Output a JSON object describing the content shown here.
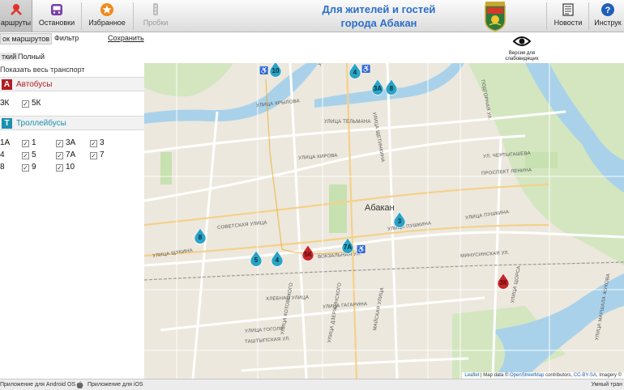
{
  "toolbar": {
    "routes_label": "аршруты",
    "stops_label": "Остановки",
    "favorites_label": "Избранное",
    "traffic_label": "Пробки",
    "news_label": "Новости",
    "instructions_label": "Инструк"
  },
  "header": {
    "title_line1": "Для жителей и гостей",
    "title_line2": "города Абакан"
  },
  "subtabs": {
    "route_list": "ок маршрутов",
    "filter": "Фильтр",
    "save": "Сохранить"
  },
  "modes": {
    "short": "ткий",
    "full": "Полный"
  },
  "show_all": "Показать весь транспорт",
  "bus_section": {
    "badge": "А",
    "title": "Автобусы",
    "color": "#b01e23"
  },
  "bus_routes": [
    "3К",
    "5К"
  ],
  "trolley_section": {
    "badge": "Т",
    "title": "Троллейбусы",
    "color": "#1c8fae"
  },
  "trolley_routes": [
    "1А",
    "1",
    "3А",
    "3",
    "4",
    "5",
    "7А",
    "7",
    "8",
    "9",
    "10"
  ],
  "vision": {
    "label1": "Версия для",
    "label2": "слабовидящих"
  },
  "map": {
    "city": "Абакан",
    "streets": [
      "УЛИЦА КРЫЛОВА",
      "УЛИЦА ТЕЛЬМАНА",
      "УЛИЦА КАТИ ТРО",
      "ПОДГОРНАЯ УЛ.",
      "УЛИЦА ЩЕТИНКИНА",
      "УЛИЦА КИРОВА",
      "УЛ. ЧЕРТЫГАШЕВА",
      "ПРОСПЕКТ ЛЕНИНА",
      "УЛИЦА ПУШКИНА",
      "УЛИЦА ПУШКИНА",
      "СОВЕТСКАЯ УЛИЦА",
      "ВОКЗАЛЬНАЯ УЛ.",
      "МИНУСИНСКАЯ УЛ.",
      "УЛИЦА ЩОРСА",
      "ХЛЕБНАЯ УЛИЦА",
      "УЛИЦА ГАГАРИНА",
      "УЛИЦА ГОГОЛЯ",
      "ТАШТЫПСКАЯ УЛ.",
      "УЛИЦА КОТОВСКОГО",
      "УЛИЦА ДЗЕРЖИНСКОГО",
      "МАЙСКАЯ УЛИЦА",
      "УЛИЦА МАРШАЛА ЖУКОВА",
      "УЛИЦА ЩУКИНА"
    ],
    "markers": [
      {
        "label": "10",
        "type": "trolley"
      },
      {
        "label": "4",
        "type": "trolley"
      },
      {
        "label": "3А",
        "type": "trolley"
      },
      {
        "label": "8",
        "type": "trolley"
      },
      {
        "label": "3",
        "type": "trolley"
      },
      {
        "label": "8",
        "type": "trolley"
      },
      {
        "label": "5",
        "type": "trolley"
      },
      {
        "label": "4",
        "type": "trolley"
      },
      {
        "label": "5К",
        "type": "bus"
      },
      {
        "label": "7А",
        "type": "trolley"
      },
      {
        "label": "3К",
        "type": "bus"
      }
    ],
    "attribution": {
      "leaflet": "Leaflet",
      "text": " | Map data © ",
      "osm": "OpenStreetMap",
      "text2": " contributors, ",
      "license": "CC-BY-SA",
      "text3": ", Imagery ©"
    }
  },
  "footer": {
    "android": "Приложение для Android OS",
    "ios": "Приложение для iOS",
    "right": "Умный тран"
  },
  "colors": {
    "trolley": "#2aa3c5",
    "bus": "#c4262b",
    "title": "#2b6fc9",
    "water": "#a9d2ea",
    "park": "#c7e1b0"
  }
}
